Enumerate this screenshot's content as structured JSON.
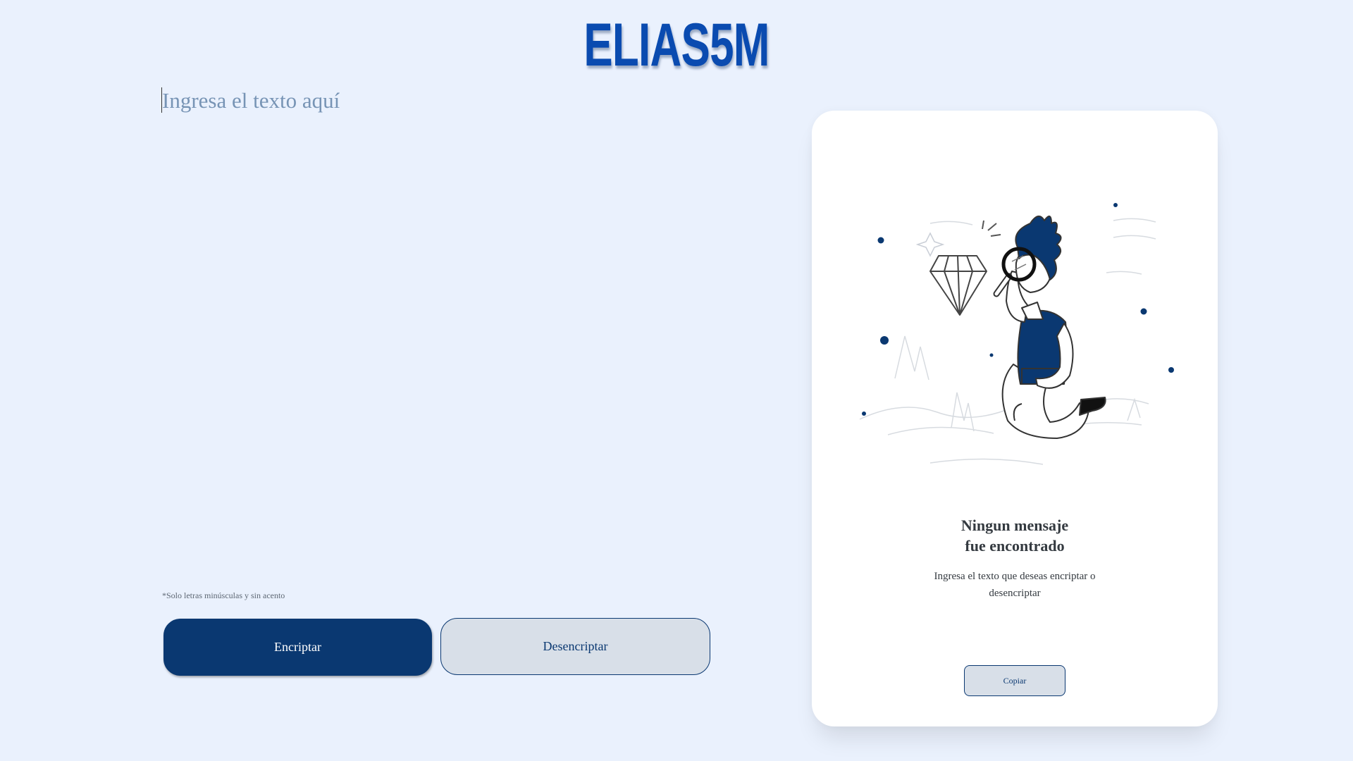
{
  "header": {
    "logo_text": "ELIAS5M"
  },
  "input": {
    "placeholder": "Ingresa el texto aquí",
    "value": ""
  },
  "hint": {
    "text": "*Solo letras minúsculas y sin acento"
  },
  "actions": {
    "encrypt_label": "Encriptar",
    "decrypt_label": "Desencriptar"
  },
  "output_card": {
    "title_line1": "Ningun mensaje",
    "title_line2": "fue encontrado",
    "subtitle": "Ingresa el texto que deseas encriptar o desencriptar",
    "copy_label": "Copiar",
    "illustration": "person-with-magnifying-glass-and-diamond"
  },
  "colors": {
    "background": "#eaf1fd",
    "primary": "#0a3871",
    "logo": "#0a4bb0",
    "secondary_button": "#d8dfe8",
    "placeholder": "#7794b5",
    "card": "#ffffff"
  }
}
